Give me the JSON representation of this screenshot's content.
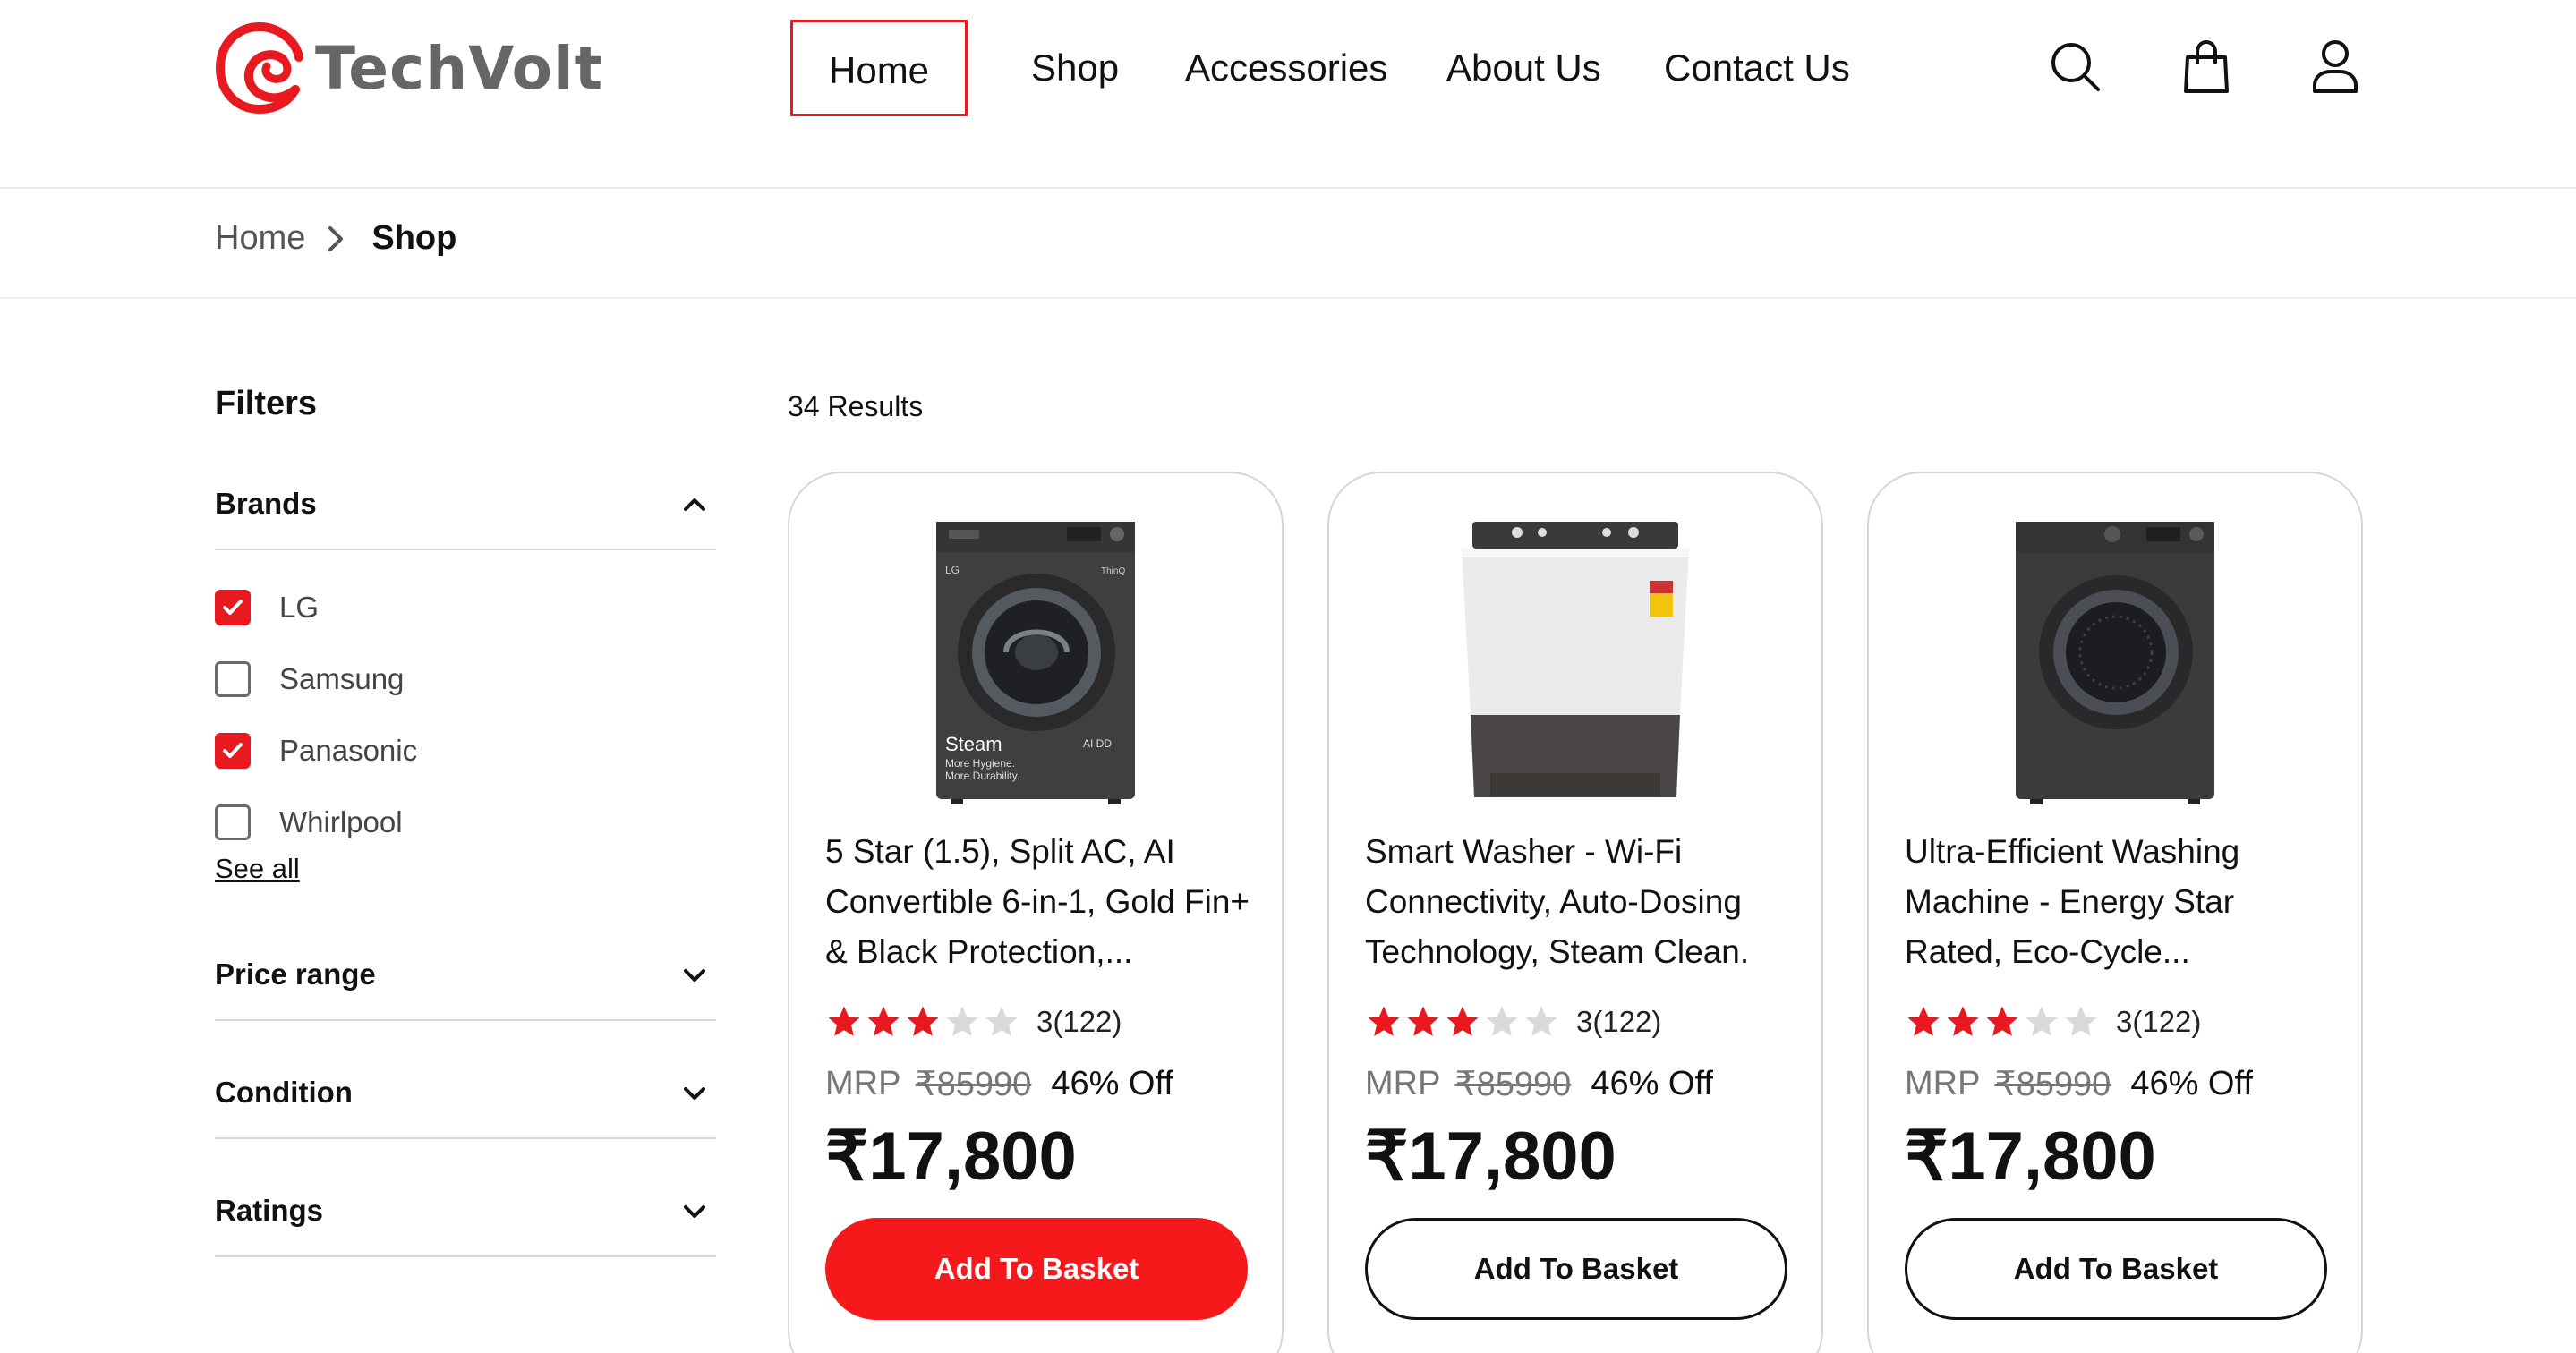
{
  "brand": {
    "name": "TechVolt",
    "color": "#e8191f"
  },
  "nav": {
    "items": [
      {
        "label": "Home",
        "active": true
      },
      {
        "label": "Shop",
        "active": false
      },
      {
        "label": "Accessories",
        "active": false
      },
      {
        "label": "About Us",
        "active": false
      },
      {
        "label": "Contact Us",
        "active": false
      }
    ],
    "icons": [
      "search-icon",
      "shopping-bag-icon",
      "user-icon"
    ]
  },
  "breadcrumb": {
    "home": "Home",
    "current": "Shop"
  },
  "filters": {
    "title": "Filters",
    "brands": {
      "label": "Brands",
      "expanded": true,
      "options": [
        {
          "label": "LG",
          "checked": true
        },
        {
          "label": "Samsung",
          "checked": false
        },
        {
          "label": "Panasonic",
          "checked": true
        },
        {
          "label": "Whirlpool",
          "checked": false
        }
      ],
      "see_all": "See all"
    },
    "price_range": {
      "label": "Price range"
    },
    "condition": {
      "label": "Condition"
    },
    "ratings": {
      "label": "Ratings"
    }
  },
  "results": {
    "count_label": "34 Results",
    "products": [
      {
        "title": "5 Star (1.5), Split AC, AI Convertible 6-in-1, Gold Fin+ & Black Protection,...",
        "image": "front-load-washing-machine",
        "rating": 3,
        "rating_text": "3(122)",
        "mrp_label": "MRP",
        "mrp": "₹85990",
        "discount": "46% Off",
        "price": "₹17,800",
        "button": "Add To Basket",
        "button_style": "primary"
      },
      {
        "title": "Smart Washer - Wi-Fi Connectivity, Auto-Dosing Technology, Steam Clean.",
        "image": "top-load-washing-machine",
        "rating": 3,
        "rating_text": "3(122)",
        "mrp_label": "MRP",
        "mrp": "₹85990",
        "discount": "46% Off",
        "price": "₹17,800",
        "button": "Add To Basket",
        "button_style": "outline"
      },
      {
        "title": "Ultra-Efficient Washing Machine - Energy Star Rated, Eco-Cycle...",
        "image": "front-load-dryer",
        "rating": 3,
        "rating_text": "3(122)",
        "mrp_label": "MRP",
        "mrp": "₹85990",
        "discount": "46% Off",
        "price": "₹17,800",
        "button": "Add To Basket",
        "button_style": "outline"
      }
    ]
  },
  "colors": {
    "accent": "#e8191f",
    "star_on": "#e8191f",
    "star_off": "#d9d9d9"
  },
  "machine_label": {
    "logo": "LG",
    "badge": "ThinQ",
    "steam": "Steam",
    "tag1": "More Hygiene.",
    "tag2": "More Durability.",
    "ai": "AI DD"
  }
}
